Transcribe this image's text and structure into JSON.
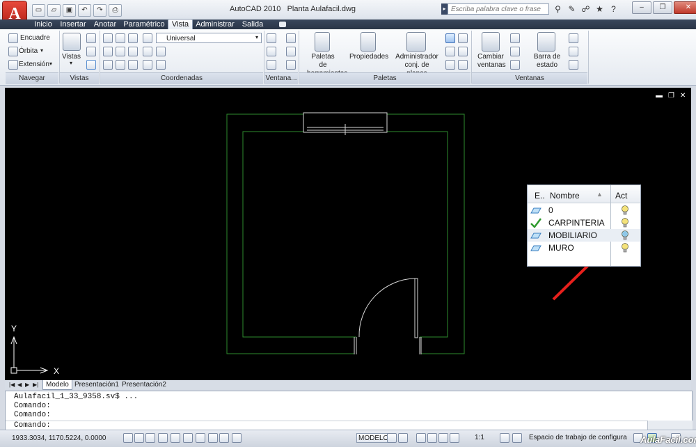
{
  "titlebar": {
    "app_name": "AutoCAD 2010",
    "document": "Planta Aulafacil.dwg",
    "search_placeholder": "Escriba palabra clave o frase",
    "app_button_label": "A"
  },
  "ribbon_tabs": [
    "Inicio",
    "Insertar",
    "Anotar",
    "Paramétrico",
    "Vista",
    "Administrar",
    "Salida"
  ],
  "active_tab": "Vista",
  "ribbon": {
    "navegar": {
      "title": "Navegar",
      "items": [
        "Encuadre",
        "Órbita",
        "Extensión"
      ]
    },
    "vistas": {
      "title": "Vistas",
      "button": "Vistas"
    },
    "coordenadas": {
      "title": "Coordenadas",
      "ucs_value": "Universal"
    },
    "ventanas_vp": {
      "title": "Ventana..."
    },
    "paletas": {
      "title": "Paletas",
      "buttons": [
        "Paletas de herramientas",
        "Propiedades",
        "Administrador conj. de planos"
      ]
    },
    "ventanas": {
      "title": "Ventanas",
      "buttons": [
        "Cambiar ventanas",
        "Barra de estado"
      ]
    }
  },
  "layer_panel": {
    "columns": {
      "status": "E..",
      "name": "Nombre",
      "on": "Act"
    },
    "layers": [
      {
        "name": "0",
        "current": false,
        "on": true,
        "bulb_color": "#f4e27a"
      },
      {
        "name": "CARPINTERIA",
        "current": true,
        "on": true,
        "bulb_color": "#f4e27a"
      },
      {
        "name": "MOBILIARIO",
        "current": false,
        "on": false,
        "bulb_color": "#8fc8e8"
      },
      {
        "name": "MURO",
        "current": false,
        "on": true,
        "bulb_color": "#f4e27a"
      }
    ]
  },
  "ucs": {
    "x_label": "X",
    "y_label": "Y"
  },
  "layout_tabs": [
    "Modelo",
    "Presentación1",
    "Presentación2"
  ],
  "active_layout": "Modelo",
  "command_line": {
    "history": [
      "Aulafacil_1_33_9358.sv$ ...",
      "Comando:",
      "Comando:"
    ],
    "prompt": "Comando:"
  },
  "statusbar": {
    "coordinates": "1933.3034, 1170.5224, 0.0000",
    "space": "MODELO",
    "scale": "1:1",
    "workspace": "Espacio de trabajo de configura"
  },
  "watermark": "AulaFacil.com",
  "colors": {
    "wall_lines": "#2e8b2e",
    "arrow": "#e8201c",
    "accent": "#2b3547"
  }
}
